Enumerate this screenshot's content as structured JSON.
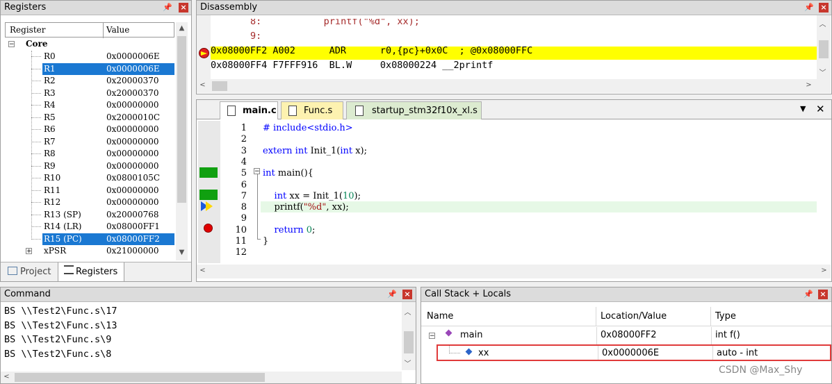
{
  "registers": {
    "title": "Registers",
    "columns": [
      "Register",
      "Value"
    ],
    "group": "Core",
    "rows": [
      {
        "name": "R0",
        "value": "0x0000006E",
        "sel": false
      },
      {
        "name": "R1",
        "value": "0x0000006E",
        "sel": true
      },
      {
        "name": "R2",
        "value": "0x20000370",
        "sel": false
      },
      {
        "name": "R3",
        "value": "0x20000370",
        "sel": false
      },
      {
        "name": "R4",
        "value": "0x00000000",
        "sel": false
      },
      {
        "name": "R5",
        "value": "0x2000010C",
        "sel": false
      },
      {
        "name": "R6",
        "value": "0x00000000",
        "sel": false
      },
      {
        "name": "R7",
        "value": "0x00000000",
        "sel": false
      },
      {
        "name": "R8",
        "value": "0x00000000",
        "sel": false
      },
      {
        "name": "R9",
        "value": "0x00000000",
        "sel": false
      },
      {
        "name": "R10",
        "value": "0x0800105C",
        "sel": false
      },
      {
        "name": "R11",
        "value": "0x00000000",
        "sel": false
      },
      {
        "name": "R12",
        "value": "0x00000000",
        "sel": false
      },
      {
        "name": "R13 (SP)",
        "value": "0x20000768",
        "sel": false
      },
      {
        "name": "R14 (LR)",
        "value": "0x08000FF1",
        "sel": false
      },
      {
        "name": "R15 (PC)",
        "value": "0x08000FF2",
        "sel": true
      }
    ],
    "xpsr": {
      "name": "xPSR",
      "value": "0x21000000"
    },
    "tabs": {
      "project": "Project",
      "registers": "Registers"
    }
  },
  "disassembly": {
    "title": "Disassembly",
    "lines": [
      {
        "text": "        8:           printf(\"%d\", xx);",
        "type": "src"
      },
      {
        "text": "        9:",
        "type": "src"
      },
      {
        "text": "0x08000FF2 A002      ADR      r0,{pc}+0x0C  ; @0x08000FFC",
        "type": "cur"
      },
      {
        "text": "0x08000FF4 F7FFF916  BL.W     0x08000224 __2printf",
        "type": "asm"
      }
    ]
  },
  "editor": {
    "tabs": [
      {
        "label": "main.c",
        "active": true
      },
      {
        "label": "Func.s",
        "active": false
      },
      {
        "label": "startup_stm32f10x_xl.s",
        "active": false
      }
    ],
    "lines": [
      {
        "n": "1",
        "html": "<span style=\"color:#0000ff\"># include&lt;stdio.h&gt;</span>"
      },
      {
        "n": "2",
        "html": ""
      },
      {
        "n": "3",
        "html": "<span class=\"kw\">extern</span> <span class=\"kw\">int</span> Init_1(<span class=\"kw\">int</span> x);"
      },
      {
        "n": "4",
        "html": ""
      },
      {
        "n": "5",
        "html": "<span class=\"kw\">int</span> main(){"
      },
      {
        "n": "6",
        "html": ""
      },
      {
        "n": "7",
        "html": "    <span class=\"kw\">int</span> xx = Init_1(<span class=\"num\">10</span>);"
      },
      {
        "n": "8",
        "html": "    printf(<span class=\"str\">\"%d\"</span>, xx);"
      },
      {
        "n": "9",
        "html": ""
      },
      {
        "n": "10",
        "html": "    <span class=\"kw\">return</span> <span class=\"num\">0</span>;"
      },
      {
        "n": "11",
        "html": "}"
      },
      {
        "n": "12",
        "html": ""
      }
    ]
  },
  "command": {
    "title": "Command",
    "lines": [
      "BS \\\\Test2\\Func.s\\17",
      "BS \\\\Test2\\Func.s\\13",
      "BS \\\\Test2\\Func.s\\9",
      "BS \\\\Test2\\Func.s\\8"
    ]
  },
  "callstack": {
    "title": "Call Stack + Locals",
    "columns": [
      "Name",
      "Location/Value",
      "Type"
    ],
    "rows": [
      {
        "name": "main",
        "value": "0x08000FF2",
        "type": "int f()"
      },
      {
        "name": "xx",
        "value": "0x0000006E",
        "type": "auto - int"
      }
    ]
  },
  "watermark": "CSDN @Max_Shy",
  "colors": {
    "selection": "#1a78d2",
    "current_line": "#ffff00",
    "exec_marker": "#10a010",
    "breakpoint": "#e00000"
  }
}
